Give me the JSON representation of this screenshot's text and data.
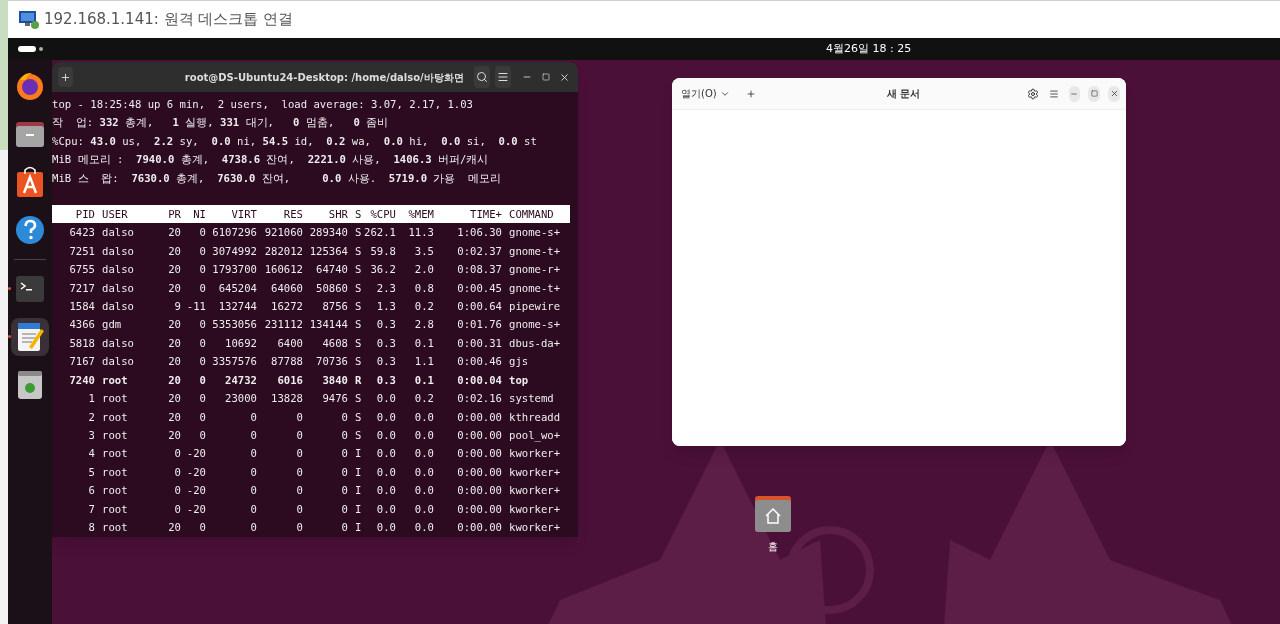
{
  "rdp_window": {
    "title": "192.168.1.141: 원격 데스크톱 연결"
  },
  "top_bar": {
    "clock": "4월26일 18 : 25"
  },
  "dock": {
    "items": [
      {
        "kind": "firefox",
        "running": false,
        "selected": false
      },
      {
        "kind": "files",
        "running": false,
        "selected": false
      },
      {
        "kind": "appcenter",
        "running": false,
        "selected": false
      },
      {
        "kind": "help",
        "running": false,
        "selected": false
      },
      {
        "kind": "terminal",
        "running": true,
        "selected": false
      },
      {
        "kind": "editor",
        "running": true,
        "selected": true
      },
      {
        "kind": "trash",
        "running": false,
        "selected": false
      }
    ]
  },
  "terminal": {
    "title": "root@DS-Ubuntu24-Desktop: /home/dalso/바탕화면",
    "summary": [
      "top - 18:25:48 up 6 min,  2 users,  load average: 3.07, 2.17, 1.03",
      "작  업: **332** 총계,   **1** 실행, **331** 대기,   **0** 멈춤,   **0** 좀비",
      "%Cpu: **43.0** us,  **2.2** sy,  **0.0** ni, **54.5** id,  **0.2** wa,  **0.0** hi,  **0.0** si,  **0.0** st",
      "MiB 메모리 :  **7940.0** 총계,  **4738.6** 잔여,  **2221.0** 사용,  **1406.3** 버퍼/캐시",
      "MiB 스  왑:  **7630.0** 총계,  **7630.0** 잔여,     **0.0** 사용.  **5719.0** 가용  메모리"
    ],
    "columns": [
      "PID",
      "USER",
      "PR",
      "NI",
      "VIRT",
      "RES",
      "SHR",
      "S",
      "%CPU",
      "%MEM",
      "TIME+",
      "COMMAND"
    ],
    "rows": [
      {
        "highlighted": false,
        "cells": [
          "6423",
          "dalso",
          "20",
          "0",
          "6107296",
          "921060",
          "289340",
          "S",
          "262.1",
          "11.3",
          "1:06.30",
          "gnome-s+"
        ]
      },
      {
        "highlighted": false,
        "cells": [
          "7251",
          "dalso",
          "20",
          "0",
          "3074992",
          "282012",
          "125364",
          "S",
          "59.8",
          "3.5",
          "0:02.37",
          "gnome-t+"
        ]
      },
      {
        "highlighted": false,
        "cells": [
          "6755",
          "dalso",
          "20",
          "0",
          "1793700",
          "160612",
          "64740",
          "S",
          "36.2",
          "2.0",
          "0:08.37",
          "gnome-r+"
        ]
      },
      {
        "highlighted": false,
        "cells": [
          "7217",
          "dalso",
          "20",
          "0",
          "645204",
          "64060",
          "50860",
          "S",
          "2.3",
          "0.8",
          "0:00.45",
          "gnome-t+"
        ]
      },
      {
        "highlighted": false,
        "cells": [
          "1584",
          "dalso",
          "9",
          "-11",
          "132744",
          "16272",
          "8756",
          "S",
          "1.3",
          "0.2",
          "0:00.64",
          "pipewire"
        ]
      },
      {
        "highlighted": false,
        "cells": [
          "4366",
          "gdm",
          "20",
          "0",
          "5353056",
          "231112",
          "134144",
          "S",
          "0.3",
          "2.8",
          "0:01.76",
          "gnome-s+"
        ]
      },
      {
        "highlighted": false,
        "cells": [
          "5818",
          "dalso",
          "20",
          "0",
          "10692",
          "6400",
          "4608",
          "S",
          "0.3",
          "0.1",
          "0:00.31",
          "dbus-da+"
        ]
      },
      {
        "highlighted": false,
        "cells": [
          "7167",
          "dalso",
          "20",
          "0",
          "3357576",
          "87788",
          "70736",
          "S",
          "0.3",
          "1.1",
          "0:00.46",
          "gjs"
        ]
      },
      {
        "highlighted": true,
        "cells": [
          "7240",
          "root",
          "20",
          "0",
          "24732",
          "6016",
          "3840",
          "R",
          "0.3",
          "0.1",
          "0:00.04",
          "top"
        ]
      },
      {
        "highlighted": false,
        "cells": [
          "1",
          "root",
          "20",
          "0",
          "23000",
          "13828",
          "9476",
          "S",
          "0.0",
          "0.2",
          "0:02.16",
          "systemd"
        ]
      },
      {
        "highlighted": false,
        "cells": [
          "2",
          "root",
          "20",
          "0",
          "0",
          "0",
          "0",
          "S",
          "0.0",
          "0.0",
          "0:00.00",
          "kthreadd"
        ]
      },
      {
        "highlighted": false,
        "cells": [
          "3",
          "root",
          "20",
          "0",
          "0",
          "0",
          "0",
          "S",
          "0.0",
          "0.0",
          "0:00.00",
          "pool_wo+"
        ]
      },
      {
        "highlighted": false,
        "cells": [
          "4",
          "root",
          "0",
          "-20",
          "0",
          "0",
          "0",
          "I",
          "0.0",
          "0.0",
          "0:00.00",
          "kworker+"
        ]
      },
      {
        "highlighted": false,
        "cells": [
          "5",
          "root",
          "0",
          "-20",
          "0",
          "0",
          "0",
          "I",
          "0.0",
          "0.0",
          "0:00.00",
          "kworker+"
        ]
      },
      {
        "highlighted": false,
        "cells": [
          "6",
          "root",
          "0",
          "-20",
          "0",
          "0",
          "0",
          "I",
          "0.0",
          "0.0",
          "0:00.00",
          "kworker+"
        ]
      },
      {
        "highlighted": false,
        "cells": [
          "7",
          "root",
          "0",
          "-20",
          "0",
          "0",
          "0",
          "I",
          "0.0",
          "0.0",
          "0:00.00",
          "kworker+"
        ]
      },
      {
        "highlighted": false,
        "cells": [
          "8",
          "root",
          "20",
          "0",
          "0",
          "0",
          "0",
          "I",
          "0.0",
          "0.0",
          "0:00.00",
          "kworker+"
        ]
      }
    ]
  },
  "editor": {
    "open_button": "열기(O)",
    "title": "새 문서"
  },
  "desktop_icons": [
    {
      "label": "홈"
    }
  ]
}
